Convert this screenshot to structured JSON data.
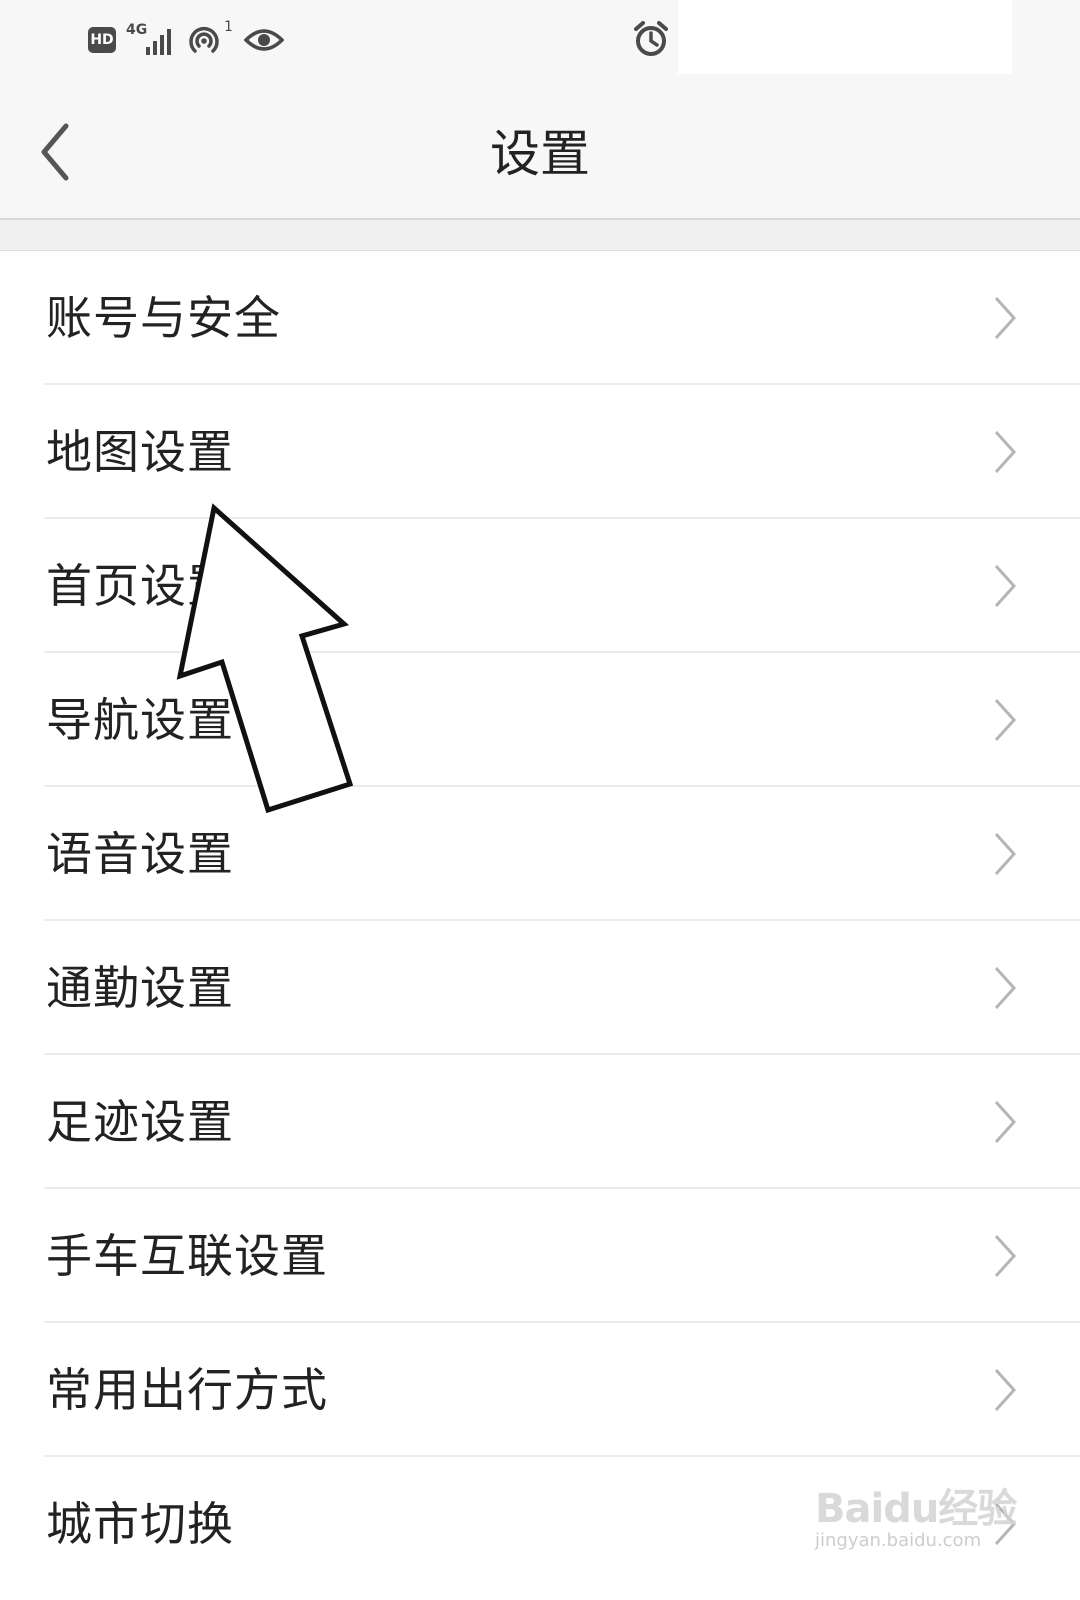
{
  "status_bar": {
    "hd_badge": "HD",
    "network_label": "4G",
    "hotspot_count": "1",
    "icons": [
      "hd-icon",
      "signal-4g-icon",
      "hotspot-icon",
      "eye-icon",
      "alarm-icon"
    ]
  },
  "header": {
    "title": "设置",
    "back_icon": "chevron-left-icon"
  },
  "settings": {
    "items": [
      {
        "label": "账号与安全"
      },
      {
        "label": "地图设置"
      },
      {
        "label": "首页设置"
      },
      {
        "label": "导航设置"
      },
      {
        "label": "语音设置"
      },
      {
        "label": "通勤设置"
      },
      {
        "label": "足迹设置"
      },
      {
        "label": "手车互联设置"
      },
      {
        "label": "常用出行方式"
      },
      {
        "label": "城市切换"
      }
    ]
  },
  "watermark": {
    "logo": "Baidu经验",
    "url": "jingyan.baidu.com"
  },
  "colors": {
    "background": "#ffffff",
    "header_bg": "#f7f7f7",
    "text": "#222222",
    "chevron": "#b5b5b5",
    "divider": "#ececec"
  }
}
